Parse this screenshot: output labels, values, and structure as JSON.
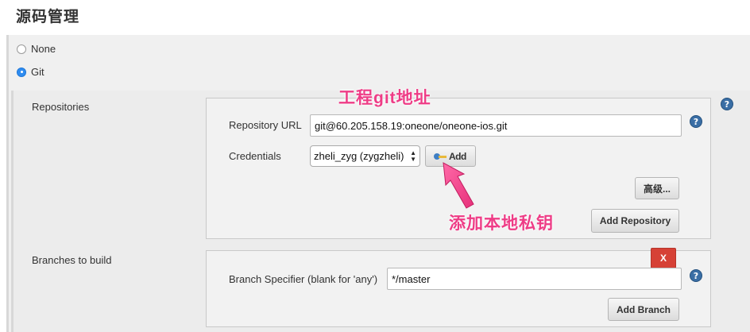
{
  "section_title": "源码管理",
  "scm_options": [
    {
      "label": "None",
      "selected": false
    },
    {
      "label": "Git",
      "selected": true
    }
  ],
  "repositories": {
    "label": "Repositories",
    "repository_url_label": "Repository URL",
    "repository_url_value": "git@60.205.158.19:oneone/oneone-ios.git",
    "credentials_label": "Credentials",
    "credentials_value": "zheli_zyg (zygzheli)",
    "add_button_label": "Add",
    "advanced_button_label": "高级...",
    "add_repository_button_label": "Add Repository"
  },
  "branches": {
    "label": "Branches to build",
    "delete_button_label": "X",
    "branch_specifier_label": "Branch Specifier (blank for 'any')",
    "branch_specifier_value": "*/master",
    "add_branch_button_label": "Add Branch"
  },
  "annotations": {
    "git_url_note": "工程git地址",
    "add_key_note": "添加本地私钥"
  },
  "colors": {
    "annotation": "#ee3c86",
    "radio_selected": "#2f8cf0",
    "help_icon": "#3a6ea5",
    "delete_button": "#d64136"
  },
  "help_icon_text": "?"
}
